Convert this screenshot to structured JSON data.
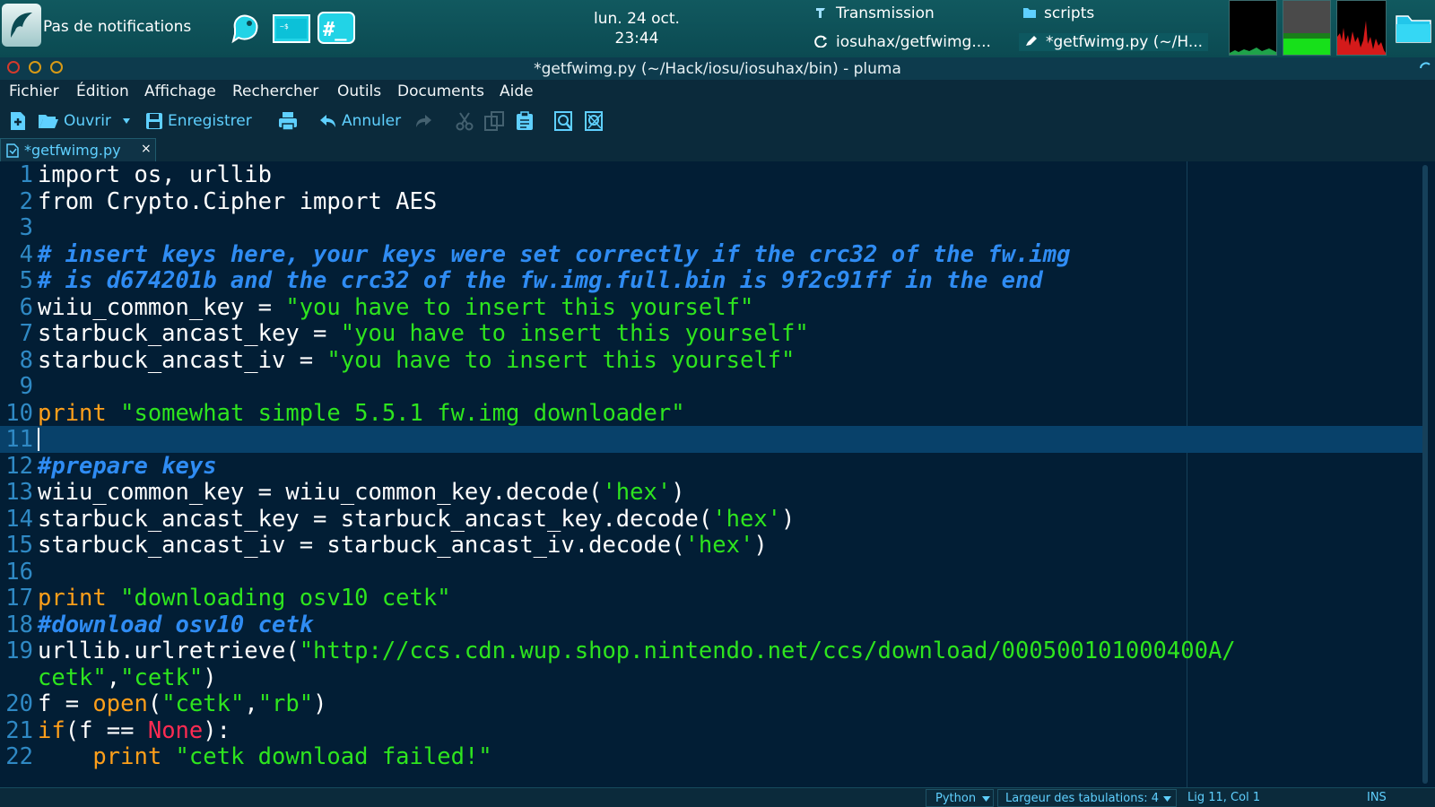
{
  "panel": {
    "notifications": "Pas de notifications",
    "clock_date": "lun. 24 oct.",
    "clock_time": "23:44",
    "tasks": [
      {
        "label": "Transmission",
        "icon": "transmission-icon"
      },
      {
        "label": "scripts",
        "icon": "folder-icon"
      },
      {
        "label": "iosuhax/getfwimg....",
        "icon": "browser-icon"
      },
      {
        "label": "*getfwimg.py (~/H...",
        "icon": "edit-icon"
      }
    ]
  },
  "window": {
    "title": "*getfwimg.py (~/Hack/iosu/iosuhax/bin) - pluma"
  },
  "menubar": {
    "items": [
      "Fichier",
      "Édition",
      "Affichage",
      "Rechercher",
      "Outils",
      "Documents",
      "Aide"
    ]
  },
  "toolbar": {
    "open_label": "Ouvrir",
    "save_label": "Enregistrer",
    "undo_label": "Annuler"
  },
  "tab": {
    "label": "*getfwimg.py",
    "close": "×"
  },
  "editor": {
    "current_line": 11,
    "lines": [
      {
        "n": "1",
        "tokens": [
          [
            "p",
            "import os, urllib"
          ]
        ]
      },
      {
        "n": "2",
        "tokens": [
          [
            "p",
            "from Crypto.Cipher import AES"
          ]
        ]
      },
      {
        "n": "3",
        "tokens": []
      },
      {
        "n": "4",
        "tokens": [
          [
            "c",
            "# insert keys here, your keys were set correctly if the crc32 of the fw.img"
          ]
        ]
      },
      {
        "n": "5",
        "tokens": [
          [
            "c",
            "# is d674201b and the crc32 of the fw.img.full.bin is 9f2c91ff in the end"
          ]
        ]
      },
      {
        "n": "6",
        "tokens": [
          [
            "p",
            "wiiu_common_key = "
          ],
          [
            "s",
            "\"you have to insert this yourself\""
          ]
        ]
      },
      {
        "n": "7",
        "tokens": [
          [
            "p",
            "starbuck_ancast_key = "
          ],
          [
            "s",
            "\"you have to insert this yourself\""
          ]
        ]
      },
      {
        "n": "8",
        "tokens": [
          [
            "p",
            "starbuck_ancast_iv = "
          ],
          [
            "s",
            "\"you have to insert this yourself\""
          ]
        ]
      },
      {
        "n": "9",
        "tokens": []
      },
      {
        "n": "10",
        "tokens": [
          [
            "k",
            "print "
          ],
          [
            "s",
            "\"somewhat simple 5.5.1 fw.img downloader\""
          ]
        ]
      },
      {
        "n": "11",
        "tokens": []
      },
      {
        "n": "12",
        "tokens": [
          [
            "c",
            "#prepare keys"
          ]
        ]
      },
      {
        "n": "13",
        "tokens": [
          [
            "p",
            "wiiu_common_key = wiiu_common_key.decode("
          ],
          [
            "s",
            "'hex'"
          ],
          [
            "p",
            ")"
          ]
        ]
      },
      {
        "n": "14",
        "tokens": [
          [
            "p",
            "starbuck_ancast_key = starbuck_ancast_key.decode("
          ],
          [
            "s",
            "'hex'"
          ],
          [
            "p",
            ")"
          ]
        ]
      },
      {
        "n": "15",
        "tokens": [
          [
            "p",
            "starbuck_ancast_iv = starbuck_ancast_iv.decode("
          ],
          [
            "s",
            "'hex'"
          ],
          [
            "p",
            ")"
          ]
        ]
      },
      {
        "n": "16",
        "tokens": []
      },
      {
        "n": "17",
        "tokens": [
          [
            "k",
            "print "
          ],
          [
            "s",
            "\"downloading osv10 cetk\""
          ]
        ]
      },
      {
        "n": "18",
        "tokens": [
          [
            "c",
            "#download osv10 cetk"
          ]
        ]
      },
      {
        "n": "19",
        "tokens": [
          [
            "p",
            "urllib.urlretrieve("
          ],
          [
            "s",
            "\"http://ccs.cdn.wup.shop.nintendo.net/ccs/download/000500101000400A/"
          ]
        ]
      },
      {
        "n": "",
        "tokens": [
          [
            "s",
            "cetk\""
          ],
          [
            "p",
            ","
          ],
          [
            "s",
            "\"cetk\""
          ],
          [
            "p",
            ")"
          ]
        ]
      },
      {
        "n": "20",
        "tokens": [
          [
            "p",
            "f = "
          ],
          [
            "k",
            "open"
          ],
          [
            "p",
            "("
          ],
          [
            "s",
            "\"cetk\""
          ],
          [
            "p",
            ","
          ],
          [
            "s",
            "\"rb\""
          ],
          [
            "p",
            ")"
          ]
        ]
      },
      {
        "n": "21",
        "tokens": [
          [
            "k",
            "if"
          ],
          [
            "p",
            "(f == "
          ],
          [
            "x",
            "None"
          ],
          [
            "p",
            "):"
          ]
        ]
      },
      {
        "n": "22",
        "tokens": [
          [
            "p",
            "    "
          ],
          [
            "k",
            "print "
          ],
          [
            "s",
            "\"cetk download failed!\""
          ]
        ]
      }
    ]
  },
  "statusbar": {
    "language": "Python",
    "tab_width": "Largeur des tabulations:  4",
    "position": "Lig 11, Col 1",
    "mode": "INS"
  },
  "colors": {
    "editor_bg": "#021e35",
    "current_line": "#08416a",
    "keyword": "#ff9f1a",
    "string": "#2ee51e",
    "comment": "#2f8cf3",
    "constant": "#ff2b52",
    "accent": "#5fd0ff"
  }
}
